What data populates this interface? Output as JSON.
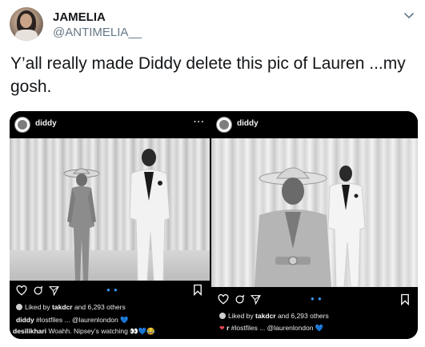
{
  "tweet": {
    "display_name": "JAMELIA",
    "handle": "@ANTIMELIA__",
    "text": "Y’all really made Diddy delete this pic of Lauren ...my gosh."
  },
  "icons": {
    "caret": "chevron-down-icon",
    "like": "heart-icon",
    "comment": "comment-bubble-icon",
    "share": "send-icon",
    "save": "bookmark-icon",
    "more": "ellipsis-icon"
  },
  "colors": {
    "link_blue": "#3897f0",
    "handle_gray": "#657786",
    "heart_red": "#ed4956"
  },
  "media": {
    "left": {
      "username": "diddy",
      "more": "···",
      "liked_prefix": "Liked by",
      "liked_user": "takdcr",
      "liked_suffix": "and 6,293 others",
      "caption_user": "diddy",
      "caption_text": "#lostfiles ... @laurenlondon 💙",
      "comment_user": "desilikhari",
      "comment_text": "Woahh. Nipsey’s watching 👀💙😂"
    },
    "right": {
      "username": "diddy",
      "more": "···",
      "liked_prefix": "Liked by",
      "liked_user": "takdcr",
      "liked_suffix": "and 6,293 others",
      "caption_user": "r",
      "caption_text": "#lostfiles ... @laurenlondon 💙"
    }
  }
}
